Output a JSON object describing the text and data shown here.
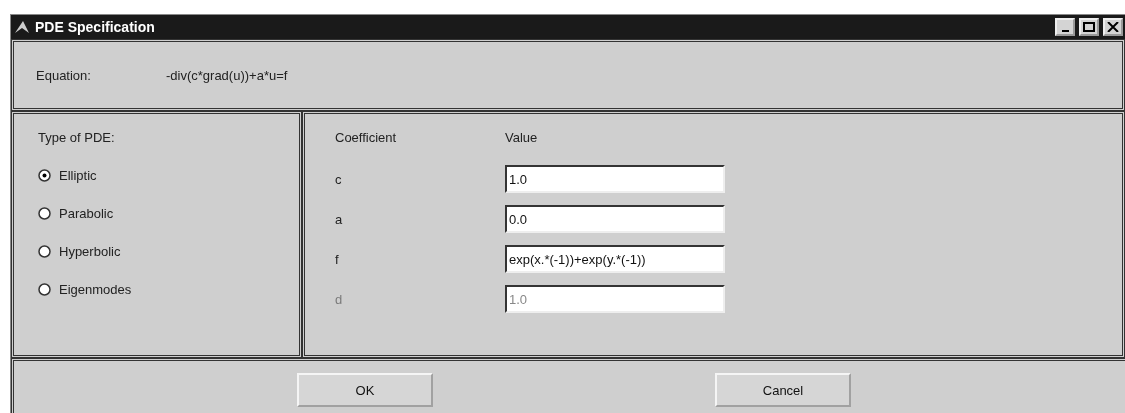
{
  "window": {
    "title": "PDE Specification"
  },
  "equation": {
    "label": "Equation:",
    "value": "-div(c*grad(u))+a*u=f"
  },
  "pde_type": {
    "label": "Type of PDE:",
    "options": [
      {
        "label": "Elliptic",
        "selected": true
      },
      {
        "label": "Parabolic",
        "selected": false
      },
      {
        "label": "Hyperbolic",
        "selected": false
      },
      {
        "label": "Eigenmodes",
        "selected": false
      }
    ]
  },
  "coefficients": {
    "columns": [
      "Coefficient",
      "Value"
    ],
    "rows": [
      {
        "name": "c",
        "value": "1.0",
        "disabled": false
      },
      {
        "name": "a",
        "value": "0.0",
        "disabled": false
      },
      {
        "name": "f",
        "value": "exp(x.*(-1))+exp(y.*(-1))",
        "disabled": false
      },
      {
        "name": "d",
        "value": "1.0",
        "disabled": true
      }
    ]
  },
  "buttons": [
    "OK",
    "Cancel"
  ]
}
